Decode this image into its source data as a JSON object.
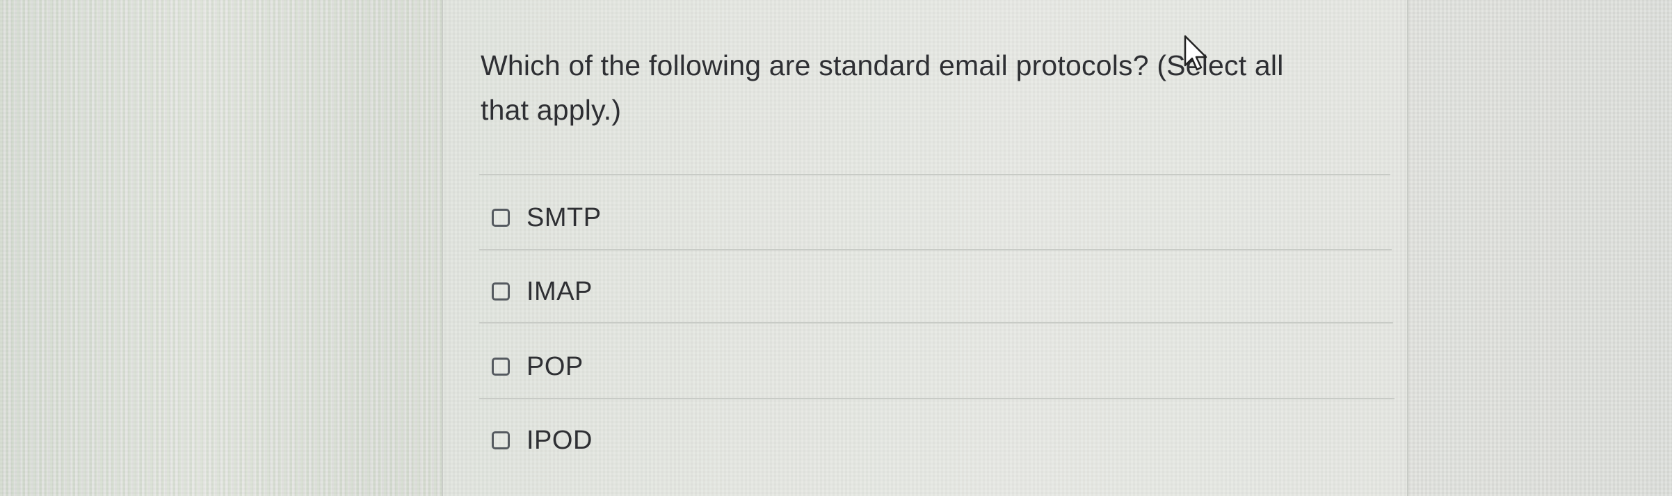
{
  "question": {
    "text": "Which of the following are standard email protocols? (Select all that apply.)"
  },
  "answers": [
    {
      "label": "SMTP",
      "checked": false
    },
    {
      "label": "IMAP",
      "checked": false
    },
    {
      "label": "POP",
      "checked": false
    },
    {
      "label": "IPOD",
      "checked": false
    }
  ],
  "colors": {
    "text": "#2e2f33",
    "checkbox_border": "#555a60",
    "divider": "#c8cbc6"
  }
}
